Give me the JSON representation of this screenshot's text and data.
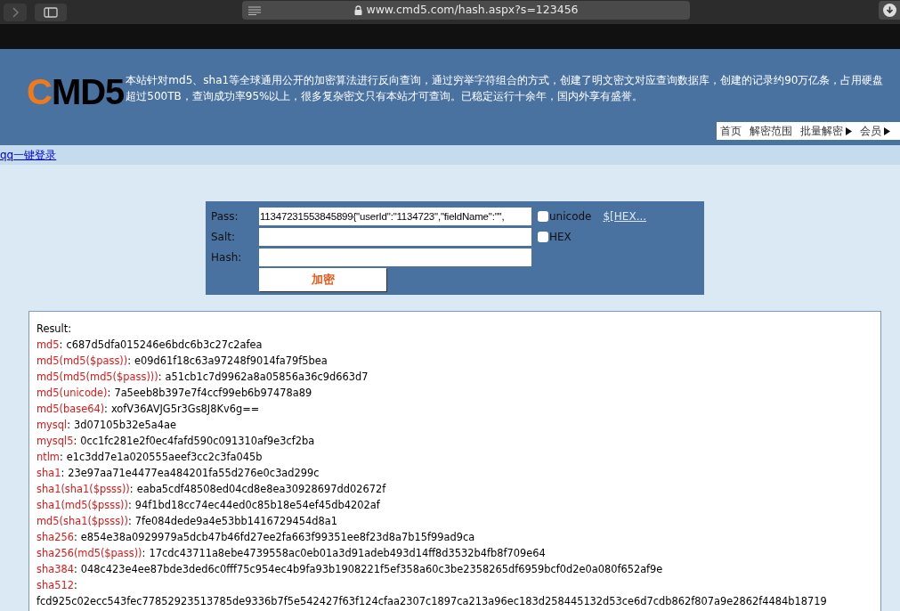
{
  "browser": {
    "url": "www.cmd5.com/hash.aspx?s=123456"
  },
  "header": {
    "logo": [
      "C",
      "MD5"
    ],
    "description": "本站针对md5、sha1等全球通用公开的加密算法进行反向查询，通过穷举字符组合的方式，创建了明文密文对应查询数据库，创建的记录约90万亿条，占用硬盘超过500TB，查询成功率95%以上，很多复杂密文只有本站才可查询。已稳定运行十余年，国内外享有盛誉。"
  },
  "nav": [
    {
      "label": "首页",
      "has_arrow": false
    },
    {
      "label": "解密范围",
      "has_arrow": false
    },
    {
      "label": "批量解密",
      "has_arrow": true
    },
    {
      "label": "会员",
      "has_arrow": true
    }
  ],
  "login_link": "qq一键登录",
  "form": {
    "rows": [
      {
        "label": "Pass:",
        "value": "11347231553845899{\"userId\":\"1134723\",\"fieldName\":\"\",",
        "checkbox": {
          "label": "unicode",
          "checked": false
        },
        "link": "$[HEX..."
      },
      {
        "label": "Salt:",
        "value": "",
        "checkbox": {
          "label": "HEX",
          "checked": false
        }
      },
      {
        "label": "Hash:",
        "value": ""
      }
    ],
    "submit": "加密"
  },
  "result": {
    "title": "Result:",
    "entries": [
      {
        "algorithm": "md5",
        "separator": ":",
        "hash": "c687d5dfa015246e6bdc6b3c27c2afea"
      },
      {
        "algorithm": "md5(md5($pass))",
        "separator": ":",
        "hash": "e09d61f18c63a97248f9014fa79f5bea"
      },
      {
        "algorithm": "md5(md5(md5($pass)))",
        "separator": ":",
        "hash": "a51cb1c7d9962a8a05856a36c9d663d7"
      },
      {
        "algorithm": "md5(unicode)",
        "separator": ":",
        "hash": "7a5eeb8b397e7f4ccf99eb6b97478a89"
      },
      {
        "algorithm": "md5(base64)",
        "separator": ":",
        "hash": "xofV36AVJG5r3Gs8J8Kv6g=="
      },
      {
        "algorithm": "mysql",
        "separator": ":",
        "hash": "3d07105b32e5a4ae"
      },
      {
        "algorithm": "mysql5",
        "separator": ":",
        "hash": "0cc1fc281e2f0ec4fafd590c091310af9e3cf2ba"
      },
      {
        "algorithm": "ntlm",
        "separator": ":",
        "hash": "e1c3dd7e1a020555aeef3cc2c3fa045b"
      },
      {
        "algorithm": "sha1",
        "separator": ":",
        "hash": "23e97aa71e4477ea484201fa55d276e0c3ad299c"
      },
      {
        "algorithm": "sha1(sha1($psss))",
        "separator": ":",
        "hash": "eaba5cdf48508ed04cd8e8ea30928697dd02672f"
      },
      {
        "algorithm": "sha1(md5($psss))",
        "separator": ":",
        "hash": "94f1bd18cc74ec44ed0c85b18e54ef45db4202af"
      },
      {
        "algorithm": "md5(sha1($psss))",
        "separator": ":",
        "hash": "7fe084dede9a4e53bb1416729454d8a1"
      },
      {
        "algorithm": "sha256",
        "separator": ":",
        "hash": "e854e38a0929979a5dcb47b46fd27ee2fa663f99351ee8f23d8a7b15f99ad9ca"
      },
      {
        "algorithm": "sha256(md5($pass))",
        "separator": ":",
        "hash": "17cdc43711a8ebe4739558ac0eb01a3d91adeb493d14ff8d3532b4fb8f709e64"
      },
      {
        "algorithm": "sha384",
        "separator": ":",
        "hash": "048c423e4ee87bde3ded6c0fff75c954ec4b9fa93b1908221f5ef358a60c3be2358265df6959bcf0d2e0a080f652af9e"
      },
      {
        "algorithm": "sha512",
        "separator": ":",
        "hash": "fcd925c02ecc543fec77852923513785de9336b7f5e542427f63f124cfaa2307c1897ca213a96ec183d258445132d53ce6d7cdb862f807a9e2862f4484b18719",
        "wrap": true
      }
    ]
  }
}
